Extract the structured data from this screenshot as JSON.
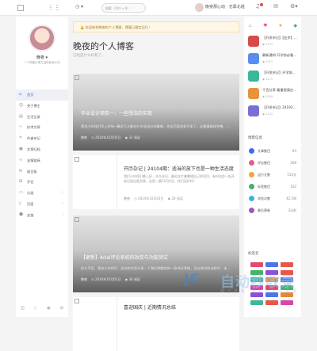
{
  "topbar": {
    "menu_icon": "grid-icon",
    "clock_icon": "clock-icon",
    "search_placeholder": "搜索（Ctrl + K）",
    "username": "晚夜那心动 · 无靠北组",
    "icons": [
      "bell-icon",
      "message-icon",
      "settings-icon"
    ]
  },
  "sidebar": {
    "name": "晚夜 ▾",
    "motto": "一个热爱分享生活的技术小白",
    "items": [
      {
        "label": "首页",
        "icon": "home-icon",
        "active": true
      },
      {
        "label": "关于博主",
        "icon": "user-icon"
      },
      {
        "label": "生活记录",
        "icon": "book-icon"
      },
      {
        "label": "技术文章",
        "icon": "code-icon"
      },
      {
        "label": "作者杂记",
        "icon": "pen-icon"
      },
      {
        "label": "文章归档",
        "icon": "archive-icon"
      },
      {
        "label": "友情链接",
        "icon": "link-icon"
      },
      {
        "label": "留言板",
        "icon": "chat-icon"
      },
      {
        "label": "开往",
        "icon": "train-icon"
      },
      {
        "label": "分类",
        "icon": "folder-icon",
        "chevron": true
      },
      {
        "label": "页面",
        "icon": "page-icon",
        "chevron": true
      },
      {
        "label": "友链",
        "icon": "friend-icon",
        "chevron": true
      }
    ],
    "bottom_icons": [
      "rss-icon",
      "qq-icon",
      "wechat-icon",
      "github-icon"
    ]
  },
  "notice": "欢迎来到晚夜的个人博客，博客已稳定运行！",
  "blog": {
    "title": "晚夜的个人博客",
    "subtitle": "已经是什么好看了。"
  },
  "posts": [
    {
      "title": "毕业设计项目一：一些想法的实现",
      "excerpt": "我也小伙伴们早上好呀~最近几天都在忙毕业设计的事情，作业后面也差不多了，还需要继续完善，会写一些相关的文章…",
      "date": "2024年10月05日",
      "author": "晚夜",
      "views": "32 阅读"
    },
    {
      "title": "开历杂记 | 24104期：适当的放下也是一种生活态度",
      "excerpt": "我们小伙伴们晚上好，许久未见，最近在忙着整理自己的项目，有时也会一起开始记录出版文章，这是一篇10月4日，你们还好吗？",
      "date": "2024年10月03日",
      "author": "晚夜",
      "views": "28 阅读"
    },
    {
      "title": "【更新】Arial评论系统的改变与功能测试",
      "excerpt": "好久不见，我也小伙伴们，这次和大家分享一下我近期使用的一款评论系统，还在测试的过程中，未必完美…",
      "date": "2024年10月01日",
      "author": "晚夜",
      "views": "36 阅读"
    },
    {
      "title": "喜迎国庆 | 近期情况总结",
      "excerpt": "",
      "date": "",
      "author": "",
      "views": ""
    }
  ],
  "right": {
    "tab_icons": [
      "fire-icon",
      "heart-icon",
      "star-icon",
      "tag-icon"
    ],
    "posts": [
      {
        "title": "【开发杂记】【业余】…",
        "views": "1371",
        "color": "#d94a4a"
      },
      {
        "title": "最新通知-开学前必看…",
        "views": "1311",
        "color": "#5b8def"
      },
      {
        "title": "【开发杂记】开学前必…",
        "views": "1271",
        "color": "#3bb79a"
      },
      {
        "title": "千百分享-看重视频应…",
        "views": "1209",
        "color": "#e8923b"
      },
      {
        "title": "【开发杂记】24192期…",
        "views": "1121",
        "color": "#7a6fd6"
      }
    ],
    "stats_head": "博客信息",
    "stats": [
      {
        "label": "文章数目",
        "value": "94",
        "color": "#3a6df0"
      },
      {
        "label": "评论数目",
        "value": "268",
        "color": "#e65c8f"
      },
      {
        "label": "运行天数",
        "value": "512天",
        "color": "#f0a43a"
      },
      {
        "label": "标签数目",
        "value": "102",
        "color": "#47b06f"
      },
      {
        "label": "浏览次数",
        "value": "42.1W",
        "color": "#3ab5d6"
      },
      {
        "label": "最后更新",
        "value": "3天前",
        "color": "#9b59b6"
      }
    ],
    "tags_head": "标签云",
    "tags": [
      "#e04b6b",
      "#4a77e6",
      "#e6584a",
      "#48b16f",
      "#8b51d8",
      "#e6584a",
      "#43b49b",
      "#e4873e",
      "#4a77e6",
      "#d548a6",
      "#e04b6b",
      "#48b16f",
      "#8b51d8",
      "#4a77e6",
      "#e4873e",
      "#43b49b",
      "#e6584a",
      "#d548a6"
    ]
  },
  "watermark": {
    "logo": "JC",
    "text": "自动秒收录",
    "sub": "收 上 打 笔 · 天 钉 一 天 只 收 录"
  }
}
